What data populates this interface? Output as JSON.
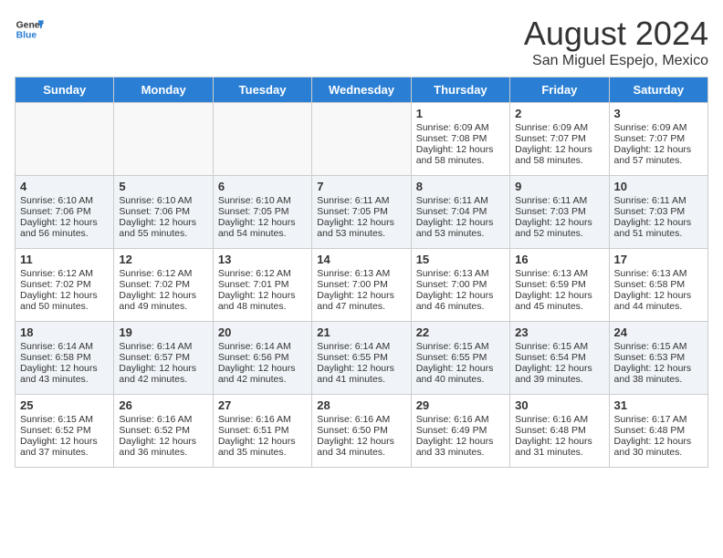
{
  "header": {
    "logo_line1": "General",
    "logo_line2": "Blue",
    "title": "August 2024",
    "subtitle": "San Miguel Espejo, Mexico"
  },
  "days_of_week": [
    "Sunday",
    "Monday",
    "Tuesday",
    "Wednesday",
    "Thursday",
    "Friday",
    "Saturday"
  ],
  "weeks": [
    [
      {
        "day": "",
        "content": ""
      },
      {
        "day": "",
        "content": ""
      },
      {
        "day": "",
        "content": ""
      },
      {
        "day": "",
        "content": ""
      },
      {
        "day": "1",
        "content": "Sunrise: 6:09 AM\nSunset: 7:08 PM\nDaylight: 12 hours\nand 58 minutes."
      },
      {
        "day": "2",
        "content": "Sunrise: 6:09 AM\nSunset: 7:07 PM\nDaylight: 12 hours\nand 58 minutes."
      },
      {
        "day": "3",
        "content": "Sunrise: 6:09 AM\nSunset: 7:07 PM\nDaylight: 12 hours\nand 57 minutes."
      }
    ],
    [
      {
        "day": "4",
        "content": "Sunrise: 6:10 AM\nSunset: 7:06 PM\nDaylight: 12 hours\nand 56 minutes."
      },
      {
        "day": "5",
        "content": "Sunrise: 6:10 AM\nSunset: 7:06 PM\nDaylight: 12 hours\nand 55 minutes."
      },
      {
        "day": "6",
        "content": "Sunrise: 6:10 AM\nSunset: 7:05 PM\nDaylight: 12 hours\nand 54 minutes."
      },
      {
        "day": "7",
        "content": "Sunrise: 6:11 AM\nSunset: 7:05 PM\nDaylight: 12 hours\nand 53 minutes."
      },
      {
        "day": "8",
        "content": "Sunrise: 6:11 AM\nSunset: 7:04 PM\nDaylight: 12 hours\nand 53 minutes."
      },
      {
        "day": "9",
        "content": "Sunrise: 6:11 AM\nSunset: 7:03 PM\nDaylight: 12 hours\nand 52 minutes."
      },
      {
        "day": "10",
        "content": "Sunrise: 6:11 AM\nSunset: 7:03 PM\nDaylight: 12 hours\nand 51 minutes."
      }
    ],
    [
      {
        "day": "11",
        "content": "Sunrise: 6:12 AM\nSunset: 7:02 PM\nDaylight: 12 hours\nand 50 minutes."
      },
      {
        "day": "12",
        "content": "Sunrise: 6:12 AM\nSunset: 7:02 PM\nDaylight: 12 hours\nand 49 minutes."
      },
      {
        "day": "13",
        "content": "Sunrise: 6:12 AM\nSunset: 7:01 PM\nDaylight: 12 hours\nand 48 minutes."
      },
      {
        "day": "14",
        "content": "Sunrise: 6:13 AM\nSunset: 7:00 PM\nDaylight: 12 hours\nand 47 minutes."
      },
      {
        "day": "15",
        "content": "Sunrise: 6:13 AM\nSunset: 7:00 PM\nDaylight: 12 hours\nand 46 minutes."
      },
      {
        "day": "16",
        "content": "Sunrise: 6:13 AM\nSunset: 6:59 PM\nDaylight: 12 hours\nand 45 minutes."
      },
      {
        "day": "17",
        "content": "Sunrise: 6:13 AM\nSunset: 6:58 PM\nDaylight: 12 hours\nand 44 minutes."
      }
    ],
    [
      {
        "day": "18",
        "content": "Sunrise: 6:14 AM\nSunset: 6:58 PM\nDaylight: 12 hours\nand 43 minutes."
      },
      {
        "day": "19",
        "content": "Sunrise: 6:14 AM\nSunset: 6:57 PM\nDaylight: 12 hours\nand 42 minutes."
      },
      {
        "day": "20",
        "content": "Sunrise: 6:14 AM\nSunset: 6:56 PM\nDaylight: 12 hours\nand 42 minutes."
      },
      {
        "day": "21",
        "content": "Sunrise: 6:14 AM\nSunset: 6:55 PM\nDaylight: 12 hours\nand 41 minutes."
      },
      {
        "day": "22",
        "content": "Sunrise: 6:15 AM\nSunset: 6:55 PM\nDaylight: 12 hours\nand 40 minutes."
      },
      {
        "day": "23",
        "content": "Sunrise: 6:15 AM\nSunset: 6:54 PM\nDaylight: 12 hours\nand 39 minutes."
      },
      {
        "day": "24",
        "content": "Sunrise: 6:15 AM\nSunset: 6:53 PM\nDaylight: 12 hours\nand 38 minutes."
      }
    ],
    [
      {
        "day": "25",
        "content": "Sunrise: 6:15 AM\nSunset: 6:52 PM\nDaylight: 12 hours\nand 37 minutes."
      },
      {
        "day": "26",
        "content": "Sunrise: 6:16 AM\nSunset: 6:52 PM\nDaylight: 12 hours\nand 36 minutes."
      },
      {
        "day": "27",
        "content": "Sunrise: 6:16 AM\nSunset: 6:51 PM\nDaylight: 12 hours\nand 35 minutes."
      },
      {
        "day": "28",
        "content": "Sunrise: 6:16 AM\nSunset: 6:50 PM\nDaylight: 12 hours\nand 34 minutes."
      },
      {
        "day": "29",
        "content": "Sunrise: 6:16 AM\nSunset: 6:49 PM\nDaylight: 12 hours\nand 33 minutes."
      },
      {
        "day": "30",
        "content": "Sunrise: 6:16 AM\nSunset: 6:48 PM\nDaylight: 12 hours\nand 31 minutes."
      },
      {
        "day": "31",
        "content": "Sunrise: 6:17 AM\nSunset: 6:48 PM\nDaylight: 12 hours\nand 30 minutes."
      }
    ]
  ]
}
